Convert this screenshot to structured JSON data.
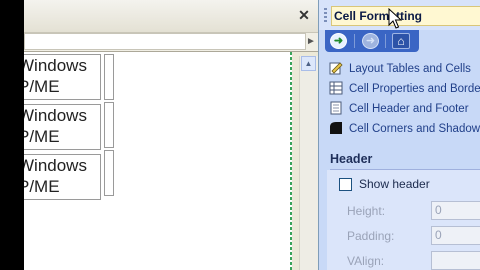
{
  "window": {
    "close_glyph": "✕"
  },
  "document": {
    "cells": [
      {
        "line1": "Windows",
        "line2": "P/ME"
      },
      {
        "line1": "Windows",
        "line2": "P/ME"
      },
      {
        "line1": "Windows",
        "line2": "P/ME"
      }
    ]
  },
  "task_pane": {
    "title": "Cell Formatting",
    "nav": {
      "back_icon": "back-arrow-icon",
      "forward_icon": "forward-arrow-icon",
      "home_icon": "home-icon"
    },
    "links": [
      {
        "label": "Layout Tables and Cells",
        "icon": "layout-table-icon"
      },
      {
        "label": "Cell Properties and Borders",
        "icon": "cell-properties-icon"
      },
      {
        "label": "Cell Header and Footer",
        "icon": "cell-header-icon"
      },
      {
        "label": "Cell Corners and Shadows",
        "icon": "cell-corners-icon"
      }
    ],
    "section": {
      "header": "Header",
      "show_header_label": "Show header",
      "show_header_checked": false,
      "fields": [
        {
          "label": "Height:",
          "value": "0"
        },
        {
          "label": "Padding:",
          "value": "0"
        },
        {
          "label": "VAlign:",
          "value": ""
        }
      ]
    }
  },
  "colors": {
    "task_pane_bg": "#c8d9f7",
    "nav_bar": "#3a65c4",
    "link_text": "#21408a",
    "title_highlight": "#fff8d2"
  }
}
